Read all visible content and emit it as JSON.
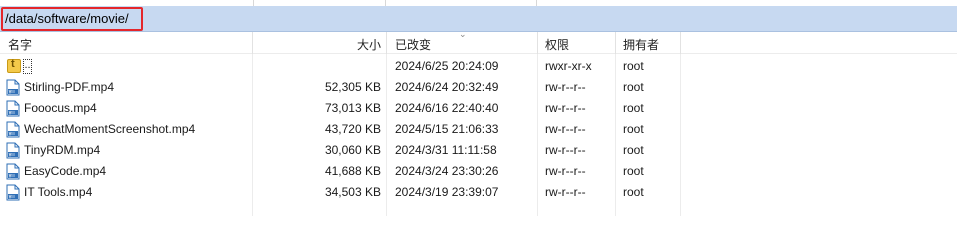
{
  "path": "/data/software/movie/",
  "columns": {
    "name": "名字",
    "size": "大小",
    "modified": "已改变",
    "permissions": "权限",
    "owner": "拥有者"
  },
  "parent_row": {
    "label": "..",
    "modified": "2024/6/25 20:24:09",
    "permissions": "rwxr-xr-x",
    "owner": "root"
  },
  "files": [
    {
      "name": "Stirling-PDF.mp4",
      "size": "52,305 KB",
      "modified": "2024/6/24 20:32:49",
      "permissions": "rw-r--r--",
      "owner": "root"
    },
    {
      "name": "Fooocus.mp4",
      "size": "73,013 KB",
      "modified": "2024/6/16 22:40:40",
      "permissions": "rw-r--r--",
      "owner": "root"
    },
    {
      "name": "WechatMomentScreenshot.mp4",
      "size": "43,720 KB",
      "modified": "2024/5/15 21:06:33",
      "permissions": "rw-r--r--",
      "owner": "root"
    },
    {
      "name": "TinyRDM.mp4",
      "size": "30,060 KB",
      "modified": "2024/3/31 11:11:58",
      "permissions": "rw-r--r--",
      "owner": "root"
    },
    {
      "name": "EasyCode.mp4",
      "size": "41,688 KB",
      "modified": "2024/3/24 23:30:26",
      "permissions": "rw-r--r--",
      "owner": "root"
    },
    {
      "name": "IT Tools.mp4",
      "size": "34,503 KB",
      "modified": "2024/3/19 23:39:07",
      "permissions": "rw-r--r--",
      "owner": "root"
    }
  ],
  "icons": {
    "file": "mp4-file-icon",
    "parent": "parent-folder-icon"
  },
  "colors": {
    "path_bar_bg": "#c7d9f1",
    "highlight_box": "#e4262b",
    "file_icon": "#2f6fb6"
  }
}
